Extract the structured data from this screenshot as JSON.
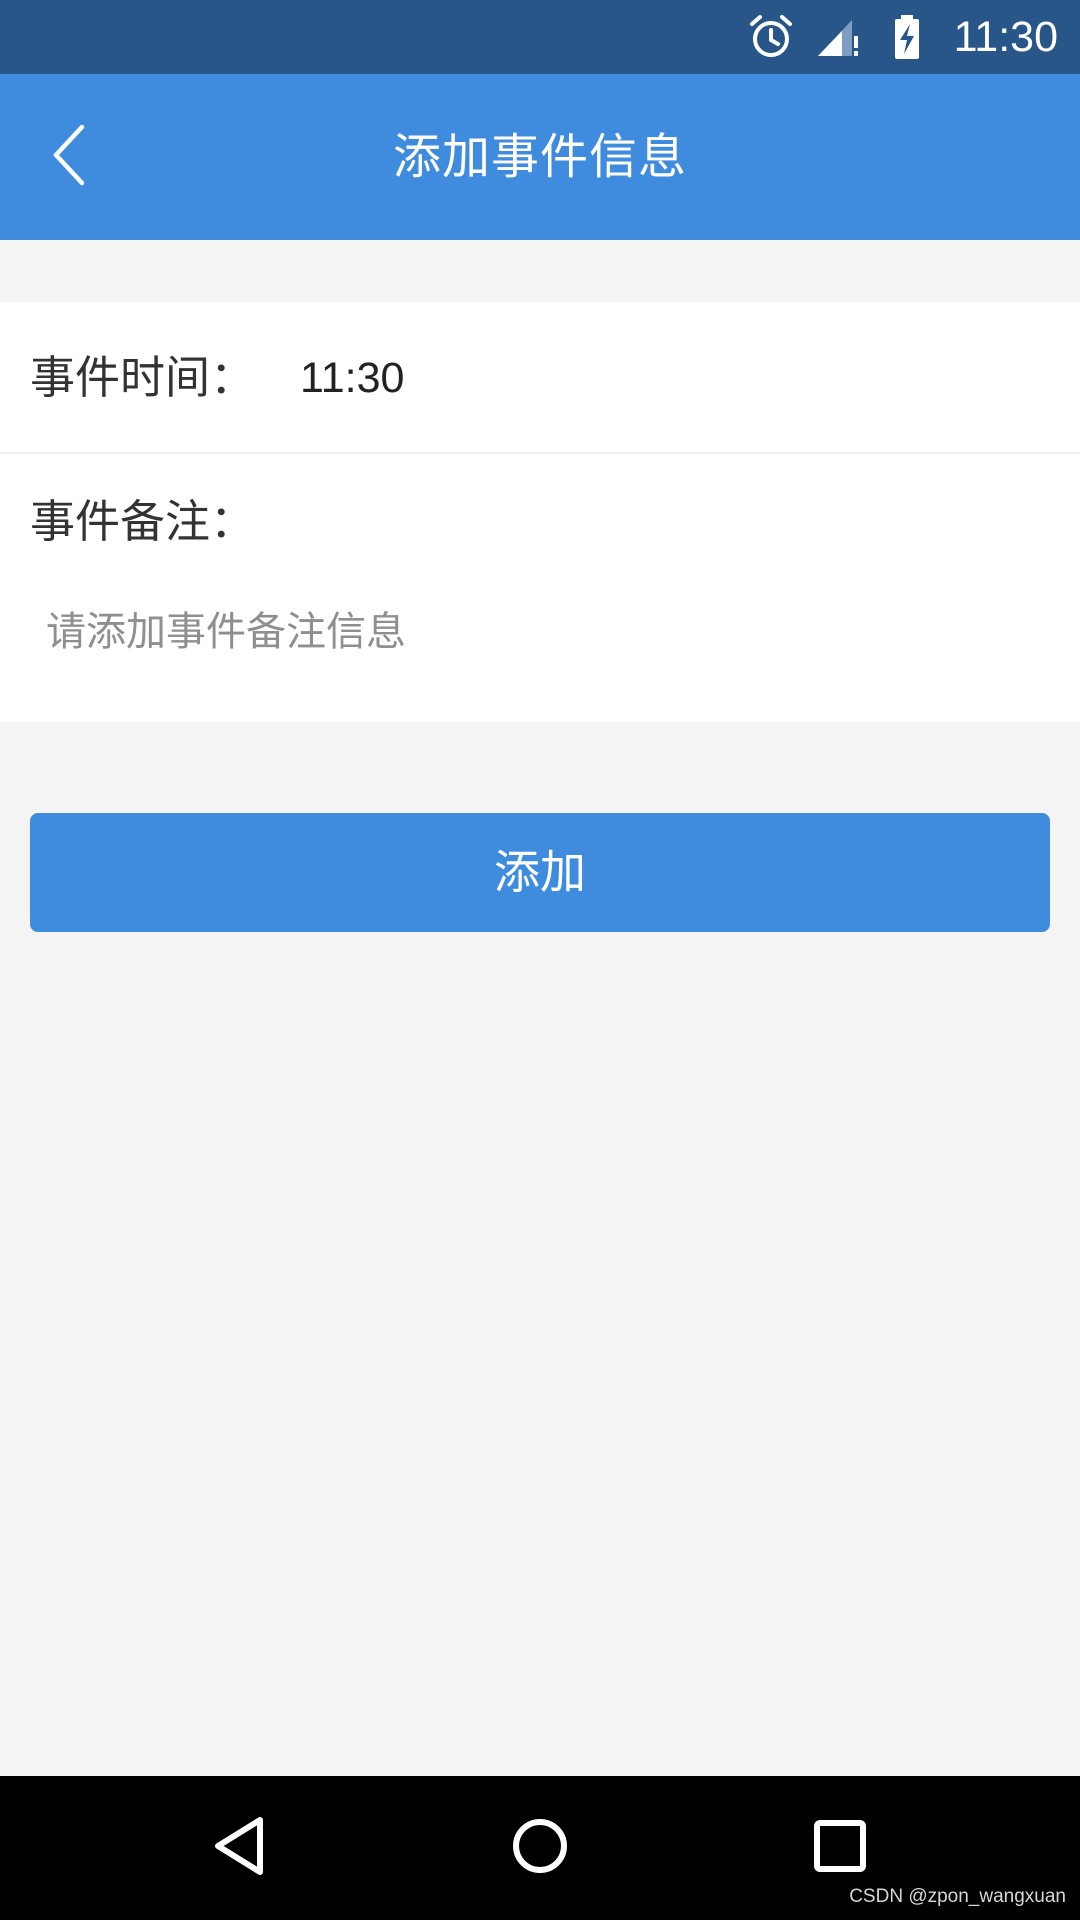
{
  "status_bar": {
    "time": "11:30",
    "icons": [
      "alarm-icon",
      "signal-icon",
      "battery-charging-icon"
    ]
  },
  "header": {
    "title": "添加事件信息",
    "back_icon": "chevron-left-icon"
  },
  "form": {
    "time_label": "事件时间：",
    "time_value": "11:30",
    "note_label": "事件备注：",
    "note_placeholder": "请添加事件备注信息",
    "note_value": ""
  },
  "add_button": {
    "label": "添加"
  },
  "nav_bar": {
    "icons": [
      "nav-back-icon",
      "nav-home-icon",
      "nav-recent-icon"
    ]
  },
  "watermark": "CSDN @zpon_wangxuan",
  "colors": {
    "status_bar": "#285689",
    "primary": "#3f8bde",
    "background": "#f4f4f4",
    "card": "#ffffff",
    "placeholder": "#8f8f8f"
  }
}
